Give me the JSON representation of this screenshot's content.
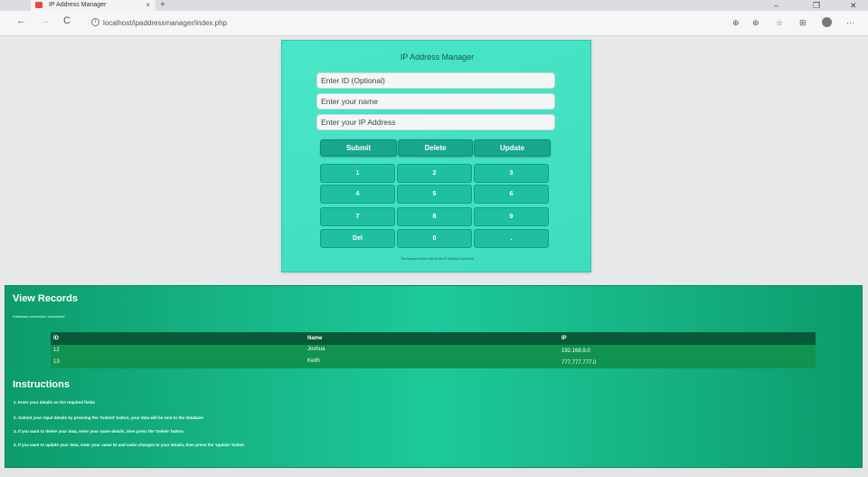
{
  "browser": {
    "tab_title": "IP Address Manager",
    "tab_close": "×",
    "new_tab": "+",
    "url": "localhost/ipaddressmanager/index.php",
    "back_icon": "←",
    "forward_icon": "→",
    "reload_icon": "C",
    "info_icon": "i",
    "window_controls": {
      "minimize": "–",
      "restore": "❐",
      "close": "✕"
    },
    "toolbar_icons": {
      "zoom": "⊕",
      "reader": "⊛",
      "favorite": "☆",
      "collections": "⊞",
      "menu": "···"
    }
  },
  "form": {
    "title": "IP Address Manager",
    "id_placeholder": "Enter ID (Optional)",
    "name_placeholder": "Enter your name",
    "ip_placeholder": "Enter your IP Address",
    "submit_label": "Submit",
    "delete_label": "Delete",
    "update_label": "Update",
    "keypad_keys": [
      "1",
      "2",
      "3",
      "4",
      "5",
      "6",
      "7",
      "8",
      "9",
      "Del",
      "0",
      "."
    ],
    "keypad_note": "The keypad works only for the IP Address input field"
  },
  "records": {
    "heading": "View Records",
    "db_status": "Database connection successful",
    "columns": [
      "ID",
      "Name",
      "IP"
    ],
    "rows": [
      {
        "id": "12",
        "name": "Joshua",
        "ip": "192.168.9.0"
      },
      {
        "id": "13",
        "name": "Keith",
        "ip": "777.777.777.0"
      }
    ]
  },
  "instructions": {
    "heading": "Instructions",
    "items": [
      "1. Enter your details on the required fields",
      "2. Submit your input details by pressing the 'Submit' button, your data will be sent to the database",
      "3. If you want to delete your data, enter your same details, then press the 'Delete' button",
      "4. If you want to update your data, enter your same ID and make changes to your details, then press the 'Update' button"
    ]
  },
  "colors": {
    "card_bg": "#49e6c7",
    "button_bg": "#18a78b",
    "key_bg": "#1ec0a1",
    "records_bg": "#16b384",
    "table_header": "#075a38",
    "table_body": "#10934f"
  }
}
